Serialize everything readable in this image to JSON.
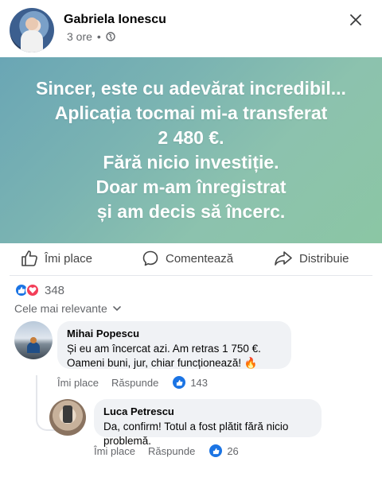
{
  "post": {
    "author": "Gabriela Ionescu",
    "time": "3 ore",
    "separator": "•",
    "privacy_icon": "globe-icon",
    "close_icon": "close-icon",
    "banner_lines": [
      "Sincer, este cu adevărat incredibil...",
      "Aplicația tocmai mi-a transferat",
      "2 480 €.",
      "Fără nicio investiție.",
      "Doar m-am înregistrat",
      "și am decis să încerc."
    ]
  },
  "actions": {
    "like": "Îmi place",
    "comment": "Comentează",
    "share": "Distribuie"
  },
  "reactions": {
    "icons": [
      "like-icon",
      "love-icon"
    ],
    "count": "348"
  },
  "sort": {
    "label": "Cele mai relevante"
  },
  "comments": [
    {
      "name": "Mihai Popescu",
      "lines": [
        "Și eu am încercat azi. Am retras 1 750 €.",
        "Oameni buni, jur, chiar funcționează! 🔥"
      ],
      "like": "Îmi place",
      "reply": "Răspunde",
      "likes": "143"
    },
    {
      "name": "Luca Petrescu",
      "lines": [
        "Da, confirm! Totul a fost plătit fără nicio problemă."
      ],
      "like": "Îmi place",
      "reply": "Răspunde",
      "likes": "26"
    }
  ],
  "colors": {
    "accent": "#1b74e4",
    "love": "#f33e58",
    "banner_from": "#6aa6b5",
    "banner_to": "#8bc6a4",
    "muted": "#65676b"
  }
}
